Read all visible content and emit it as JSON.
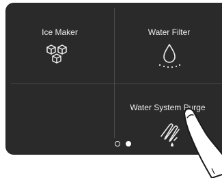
{
  "tiles": [
    {
      "label": "Ice Maker",
      "icon": "ice-cubes-icon"
    },
    {
      "label": "Water Filter",
      "icon": "water-drop-icon"
    },
    {
      "label": "",
      "icon": ""
    },
    {
      "label": "Water System Purge",
      "icon": "purge-icon"
    }
  ],
  "pagination": {
    "pages": 2,
    "active_page": 2
  },
  "colors": {
    "panel": "#2a2a2a",
    "text": "#ededed",
    "divider": "#4a4a4a"
  },
  "overlay": {
    "icon": "tapping-finger-icon"
  }
}
